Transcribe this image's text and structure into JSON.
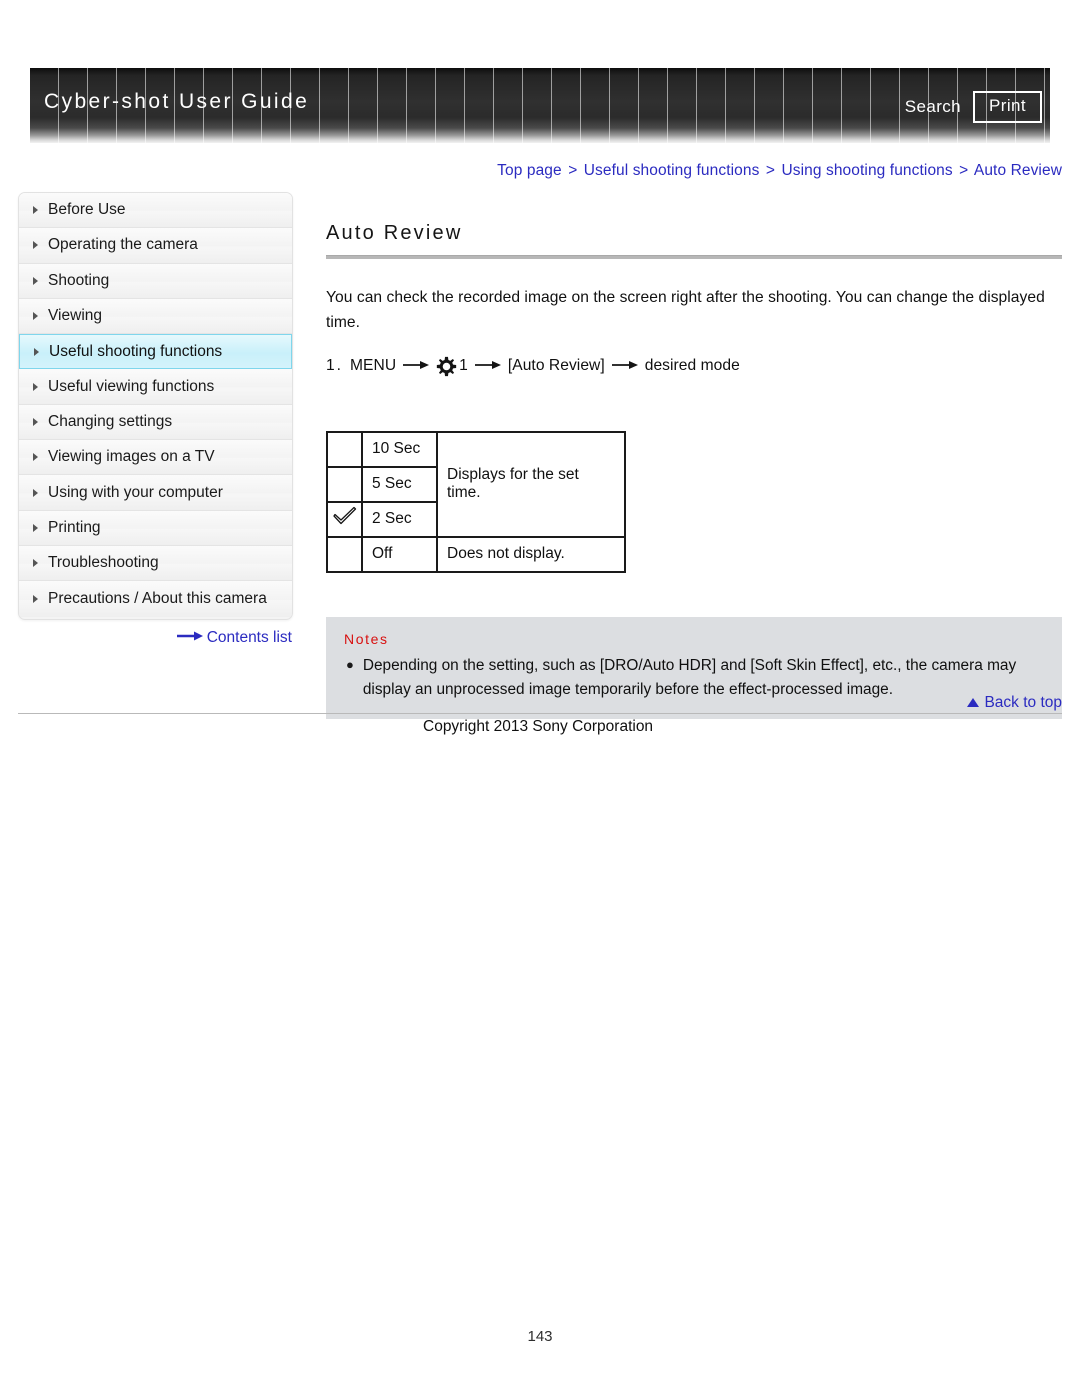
{
  "header": {
    "title": "Cyber-shot User Guide",
    "search_label": "Search",
    "print_label": "Print"
  },
  "breadcrumb": {
    "separator": ">",
    "items": [
      {
        "label": "Top page"
      },
      {
        "label": "Useful shooting functions"
      },
      {
        "label": "Using shooting functions"
      },
      {
        "label": "Auto Review"
      }
    ]
  },
  "sidebar": {
    "items": [
      {
        "label": "Before Use",
        "selected": false
      },
      {
        "label": "Operating the camera",
        "selected": false
      },
      {
        "label": "Shooting",
        "selected": false
      },
      {
        "label": "Viewing",
        "selected": false
      },
      {
        "label": "Useful shooting functions",
        "selected": true
      },
      {
        "label": "Useful viewing functions",
        "selected": false
      },
      {
        "label": "Changing settings",
        "selected": false
      },
      {
        "label": "Viewing images on a TV",
        "selected": false
      },
      {
        "label": "Using with your computer",
        "selected": false
      },
      {
        "label": "Printing",
        "selected": false
      },
      {
        "label": "Troubleshooting",
        "selected": false
      },
      {
        "label": "Precautions / About this camera",
        "selected": false
      }
    ],
    "contents_list_label": "Contents list"
  },
  "main": {
    "title": "Auto Review",
    "intro": "You can check the recorded image on the screen right after the shooting. You can change the displayed time.",
    "step": {
      "number": "1.",
      "menu_label": "MENU",
      "gear_icon": "gear-icon",
      "gear_number": "1",
      "setting_label": "[Auto Review]",
      "result_label": "desired mode",
      "arrow": "→"
    },
    "table": {
      "check_icon": "check-icon",
      "rows": [
        {
          "checked": false,
          "value": "10 Sec",
          "description": "Displays for the set time.",
          "desc_rowspan": 3
        },
        {
          "checked": false,
          "value": "5 Sec",
          "description": "",
          "desc_rowspan": 0
        },
        {
          "checked": true,
          "value": "2 Sec",
          "description": "",
          "desc_rowspan": 0
        },
        {
          "checked": false,
          "value": "Off",
          "description": "Does not display.",
          "desc_rowspan": 1
        }
      ]
    },
    "notes": {
      "title": "Notes",
      "bullet": "●",
      "items": [
        "Depending on the setting, such as [DRO/Auto HDR] and [Soft Skin Effect], etc., the camera may display an unprocessed image temporarily before the effect-processed image."
      ]
    }
  },
  "footer": {
    "back_to_top_label": "Back to top",
    "copyright": "Copyright 2013 Sony Corporation",
    "page_number": "143"
  },
  "colors": {
    "link": "#2b2bc0",
    "notes_title": "#d81010",
    "selected_nav": "#c9f0fa",
    "header_dark": "#2b2b2b",
    "notes_bg": "#dcdee1"
  }
}
